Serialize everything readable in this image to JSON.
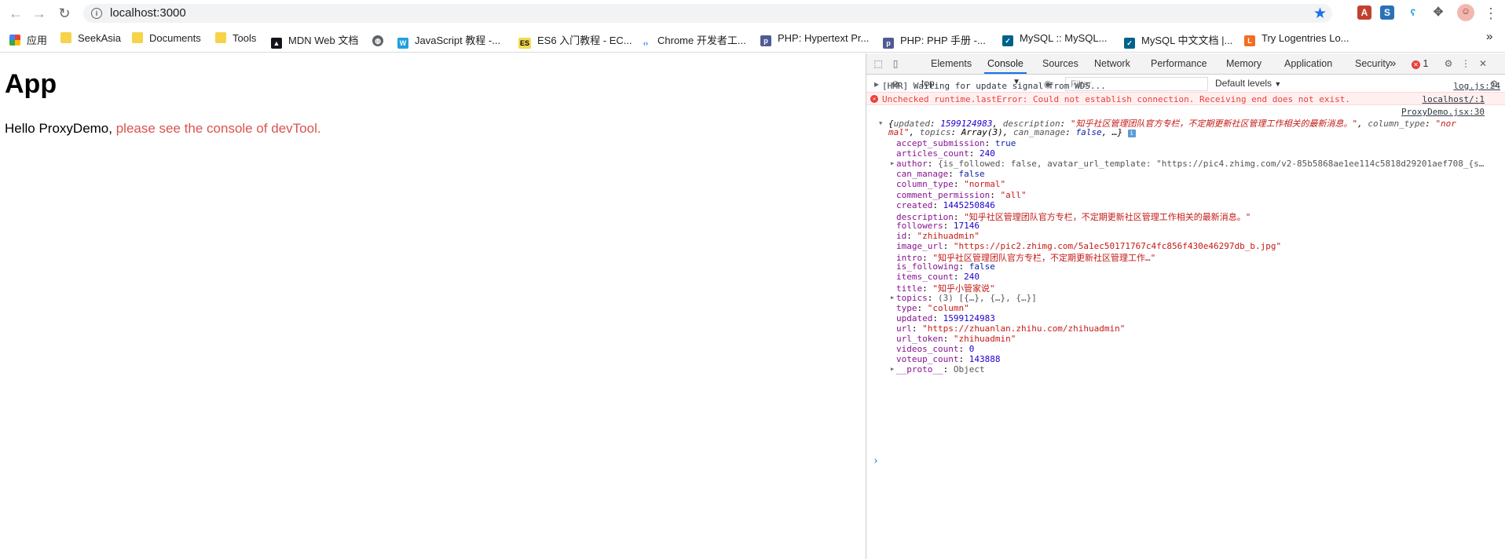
{
  "browser": {
    "url": "localhost:3000",
    "bookmarks": [
      {
        "label": "应用",
        "icon": "apps-grid-icon"
      },
      {
        "label": "SeekAsia",
        "icon": "folder-icon"
      },
      {
        "label": "Documents",
        "icon": "folder-icon"
      },
      {
        "label": "Tools",
        "icon": "folder-icon"
      },
      {
        "label": "MDN Web 文档",
        "icon": "mdn-icon"
      },
      {
        "label": "",
        "icon": "globe-icon"
      },
      {
        "label": "JavaScript 教程 -...",
        "icon": "js-icon"
      },
      {
        "label": "ES6 入门教程 - EC...",
        "icon": "es6-icon"
      },
      {
        "label": "Chrome 开发者工...",
        "icon": "chrome-icon"
      },
      {
        "label": "PHP: Hypertext Pr...",
        "icon": "php-icon"
      },
      {
        "label": "PHP: PHP 手册 -...",
        "icon": "php-icon"
      },
      {
        "label": "MySQL :: MySQL...",
        "icon": "mysql-icon"
      },
      {
        "label": "MySQL 中文文档 |...",
        "icon": "mysql-icon"
      },
      {
        "label": "Try Logentries Lo...",
        "icon": "logentries-icon"
      }
    ],
    "bookmarks_more": "»"
  },
  "page": {
    "heading": "App",
    "greeting": "Hello ProxyDemo,",
    "note": " please see the console of devTool."
  },
  "devtools": {
    "tabs": [
      "Elements",
      "Console",
      "Sources",
      "Network",
      "Performance",
      "Memory",
      "Application",
      "Security"
    ],
    "active_tab": "Console",
    "more_tabs": "»",
    "error_count": "1",
    "context": "top",
    "filter_placeholder": "Filter",
    "levels": "Default levels",
    "colors": {
      "accent": "#1a73e8",
      "error_text": "#e8403b",
      "error_bg": "#fff0f0"
    },
    "console": {
      "hmr": {
        "text": "[HMR] Waiting for update signal from WDS...",
        "src": "log.js:24"
      },
      "error": {
        "text": "Unchecked runtime.lastError: Could not establish connection. Receiving end does not exist.",
        "src": "localhost/:1"
      },
      "obj_src": "ProxyDemo.jsx:30",
      "summary_line1": {
        "k1": "updated",
        "v1": "1599124983",
        "k2": "description",
        "v2": "\"知乎社区管理团队官方专栏，不定期更新社区管理工作相关的最新消息。\"",
        "k3": "column_type",
        "v3": "\"nor"
      },
      "summary_line2": {
        "v3b": "mal\"",
        "k4": "topics",
        "v4": "Array(3)",
        "k5": "can_manage",
        "v5": "false",
        "tail": ", …}"
      },
      "props": [
        {
          "key": "accept_submission",
          "value": "true",
          "type": "b"
        },
        {
          "key": "articles_count",
          "value": "240",
          "type": "n"
        },
        {
          "key": "author",
          "value": "{is_followed: false, avatar_url_template: \"https://pic4.zhimg.com/v2-85b5868ae1ee114c5818d29201aef708_{s…",
          "type": "g",
          "expand": true
        },
        {
          "key": "can_manage",
          "value": "false",
          "type": "b"
        },
        {
          "key": "column_type",
          "value": "\"normal\"",
          "type": "s"
        },
        {
          "key": "comment_permission",
          "value": "\"all\"",
          "type": "s"
        },
        {
          "key": "created",
          "value": "1445250846",
          "type": "n"
        },
        {
          "key": "description",
          "value": "\"知乎社区管理团队官方专栏，不定期更新社区管理工作相关的最新消息。\"",
          "type": "s"
        },
        {
          "key": "followers",
          "value": "17146",
          "type": "n"
        },
        {
          "key": "id",
          "value": "\"zhihuadmin\"",
          "type": "s"
        },
        {
          "key": "image_url",
          "value": "\"https://pic2.zhimg.com/5a1ec50171767c4fc856f430e46297db_b.jpg\"",
          "type": "s"
        },
        {
          "key": "intro",
          "value": "\"知乎社区管理团队官方专栏，不定期更新社区管理工作…\"",
          "type": "s"
        },
        {
          "key": "is_following",
          "value": "false",
          "type": "b"
        },
        {
          "key": "items_count",
          "value": "240",
          "type": "n"
        },
        {
          "key": "title",
          "value": "\"知乎小管家说\"",
          "type": "s"
        },
        {
          "key": "topics",
          "value": "(3) [{…}, {…}, {…}]",
          "type": "g",
          "expand": true
        },
        {
          "key": "type",
          "value": "\"column\"",
          "type": "s"
        },
        {
          "key": "updated",
          "value": "1599124983",
          "type": "n"
        },
        {
          "key": "url",
          "value": "\"https://zhuanlan.zhihu.com/zhihuadmin\"",
          "type": "s"
        },
        {
          "key": "url_token",
          "value": "\"zhihuadmin\"",
          "type": "s"
        },
        {
          "key": "videos_count",
          "value": "0",
          "type": "n"
        },
        {
          "key": "voteup_count",
          "value": "143888",
          "type": "n"
        },
        {
          "key": "__proto__",
          "value": "Object",
          "type": "g",
          "expand": true
        }
      ],
      "prompt": "›"
    }
  }
}
